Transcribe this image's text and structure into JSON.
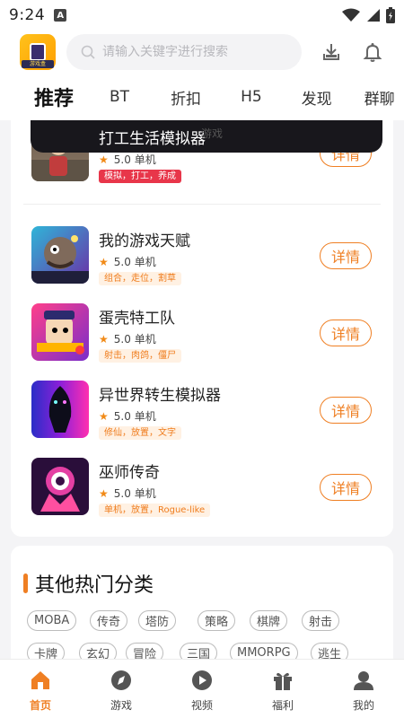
{
  "status_bar": {
    "time": "9:24",
    "notification_icon": "A"
  },
  "header": {
    "logo_label": "游戏盒",
    "search_placeholder": "请输入关键字进行搜索",
    "download_icon": "download-icon",
    "bell_icon": "bell-icon"
  },
  "tabs": [
    {
      "label": "推荐",
      "active": true
    },
    {
      "label": "BT"
    },
    {
      "label": "折扣"
    },
    {
      "label": "H5"
    },
    {
      "label": "发现"
    },
    {
      "label": "群聊"
    }
  ],
  "banner": {
    "title": "打工生活模拟器",
    "faint_text": "游戏"
  },
  "games": [
    {
      "name": "打工生活模拟器",
      "rating": "5.0",
      "type": "单机",
      "tags": "模拟，打工，养成",
      "button": "详情"
    },
    {
      "name": "我的游戏天赋",
      "rating": "5.0",
      "type": "单机",
      "tags": "组合，走位，割草",
      "button": "详情"
    },
    {
      "name": "蛋壳特工队",
      "rating": "5.0",
      "type": "单机",
      "tags": "射击，肉鸽，僵尸",
      "button": "详情"
    },
    {
      "name": "异世界转生模拟器",
      "rating": "5.0",
      "type": "单机",
      "tags": "修仙，放置，文字",
      "button": "详情"
    },
    {
      "name": "巫师传奇",
      "rating": "5.0",
      "type": "单机",
      "tags": "单机，放置，Rogue-like",
      "button": "详情"
    }
  ],
  "categories": {
    "title": "其他热门分类",
    "items": [
      "MOBA",
      "传奇",
      "塔防",
      "策略",
      "棋牌",
      "射击",
      "卡牌",
      "玄幻",
      "冒险",
      "三国",
      "MMORPG",
      "逃生"
    ]
  },
  "bottom_nav": [
    {
      "label": "首页",
      "icon": "home-icon",
      "active": true
    },
    {
      "label": "游戏",
      "icon": "compass-icon"
    },
    {
      "label": "视频",
      "icon": "play-icon"
    },
    {
      "label": "福利",
      "icon": "gift-icon"
    },
    {
      "label": "我的",
      "icon": "user-icon"
    }
  ],
  "colors": {
    "accent": "#ef7f23",
    "tag_red": "#e8364a",
    "background": "#f4f4f6"
  }
}
